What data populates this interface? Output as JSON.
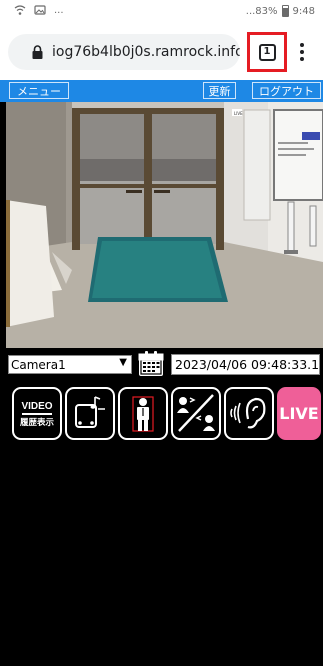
{
  "status_bar": {
    "ellipsis": "...",
    "battery": "...83%",
    "time": "9:48"
  },
  "browser": {
    "url": "iog76b4lb0j0s.ramrock.info/|",
    "tab_count": "1"
  },
  "app_header": {
    "menu_label": "メニュー",
    "refresh_label": "更新",
    "logout_label": "ログアウト"
  },
  "controls": {
    "camera_selected": "Camera1",
    "datetime": "2023/04/06 09:48:33.1"
  },
  "icon_row": {
    "video_label": "VIDEO",
    "history_label": "履歴表示",
    "live_label": "LIVE"
  },
  "camera_feed": {
    "sign_text": "LIVE"
  },
  "colors": {
    "header_blue": "#1e88e5",
    "live_pink": "#ef5f98",
    "highlight_red": "#e51c23"
  }
}
